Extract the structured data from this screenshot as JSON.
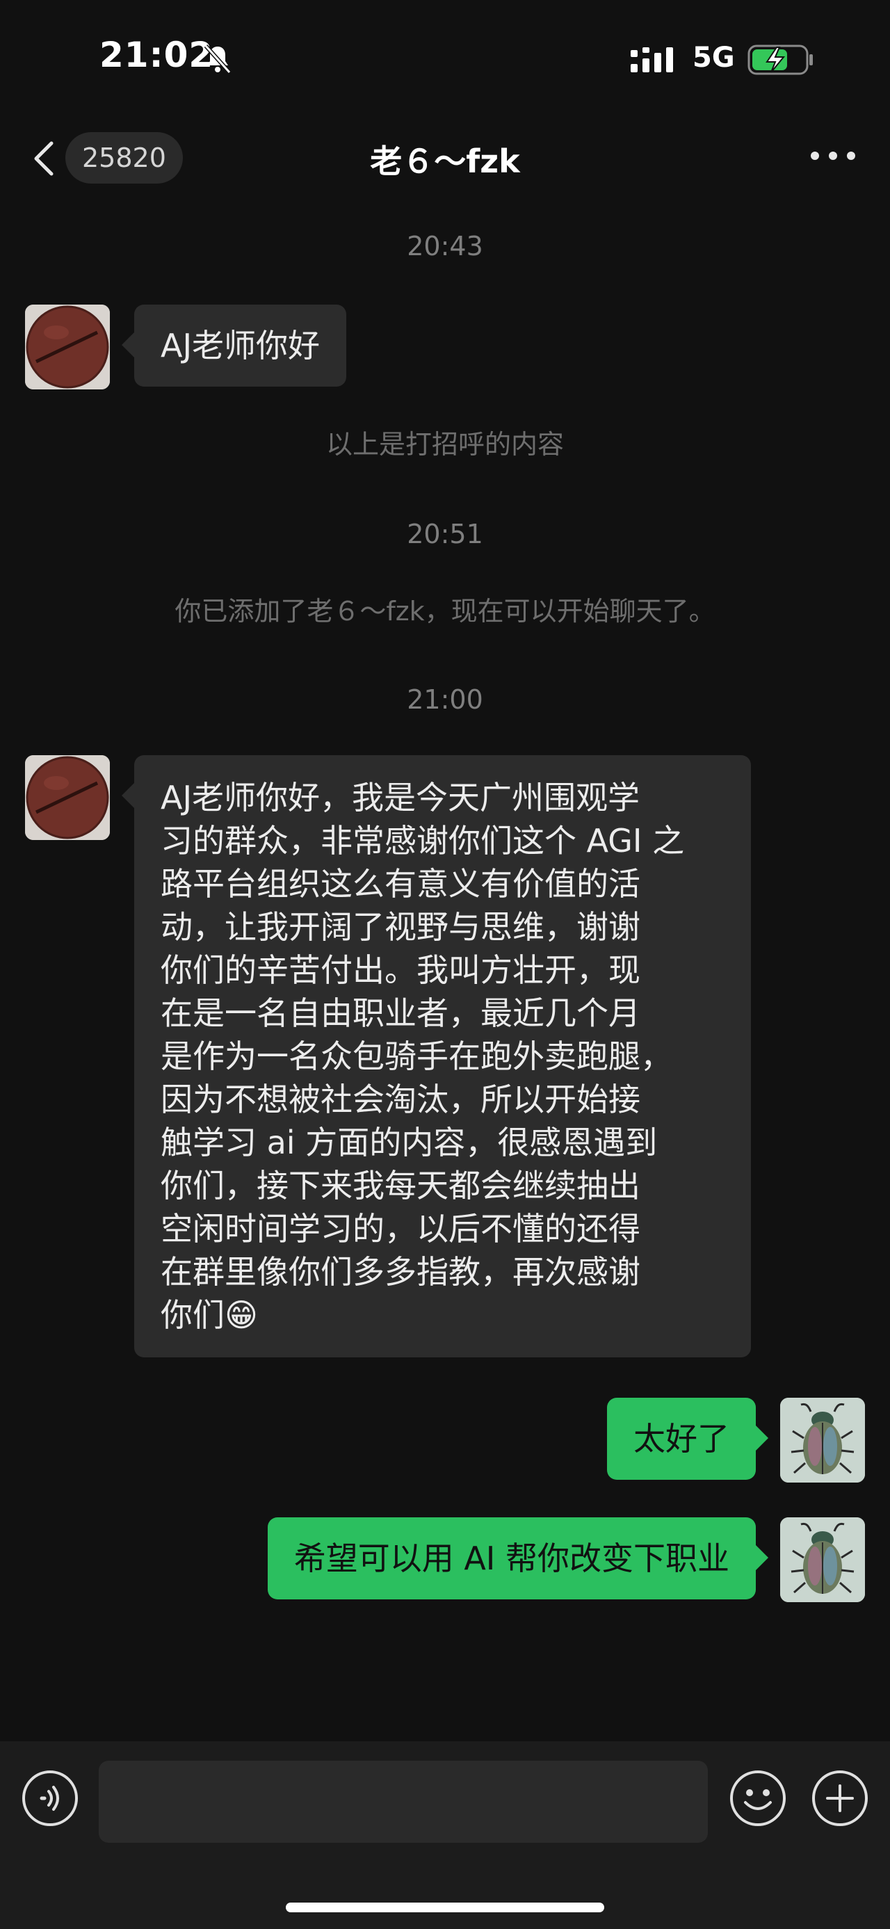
{
  "status_bar": {
    "time": "21:02",
    "network": "5G",
    "icons": [
      "bell-muted-icon",
      "signal-icon",
      "battery-charging-icon"
    ]
  },
  "nav": {
    "unread_count": "25820",
    "title": "老６～fzk",
    "icons": [
      "back-chevron-icon",
      "more-icon"
    ]
  },
  "messages": {
    "ts1": "20:43",
    "m1": "AJ老师你好",
    "note1": "以上是打招呼的内容",
    "ts2": "20:51",
    "note2": "你已添加了老６～fzk，现在可以开始聊天了。",
    "ts3": "21:00",
    "m2_lines": [
      "AJ老师你好，我是今天广州围观学",
      "习的群众，非常感谢你们这个 AGI 之",
      "路平台组织这么有意义有价值的活",
      "动，让我开阔了视野与思维，谢谢",
      "你们的辛苦付出。我叫方壮开，现",
      "在是一名自由职业者，最近几个月",
      "是作为一名众包骑手在跑外卖跑腿，",
      "因为不想被社会淘汰，所以开始接",
      "触学习 ai 方面的内容，很感恩遇到",
      "你们，接下来我每天都会继续抽出",
      "空闲时间学习的，以后不懂的还得",
      "在群里像你们多多指教，再次感谢",
      "你们😁"
    ],
    "m3": "太好了",
    "m4": "希望可以用 AI 帮你改变下职业"
  },
  "input_bar": {
    "value": "",
    "placeholder": "",
    "icons": [
      "voice-icon",
      "emoji-icon",
      "plus-icon"
    ]
  },
  "colors": {
    "background": "#111111",
    "incoming_bubble": "#2c2c2c",
    "outgoing_bubble": "#2bbf5f"
  }
}
